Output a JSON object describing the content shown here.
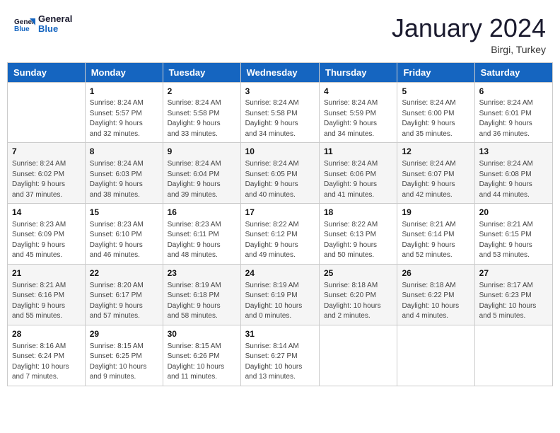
{
  "logo": {
    "line1": "General",
    "line2": "Blue"
  },
  "title": "January 2024",
  "location": "Birgi, Turkey",
  "header": {
    "days": [
      "Sunday",
      "Monday",
      "Tuesday",
      "Wednesday",
      "Thursday",
      "Friday",
      "Saturday"
    ]
  },
  "weeks": [
    [
      {
        "day": "",
        "info": ""
      },
      {
        "day": "1",
        "info": "Sunrise: 8:24 AM\nSunset: 5:57 PM\nDaylight: 9 hours\nand 32 minutes."
      },
      {
        "day": "2",
        "info": "Sunrise: 8:24 AM\nSunset: 5:58 PM\nDaylight: 9 hours\nand 33 minutes."
      },
      {
        "day": "3",
        "info": "Sunrise: 8:24 AM\nSunset: 5:58 PM\nDaylight: 9 hours\nand 34 minutes."
      },
      {
        "day": "4",
        "info": "Sunrise: 8:24 AM\nSunset: 5:59 PM\nDaylight: 9 hours\nand 34 minutes."
      },
      {
        "day": "5",
        "info": "Sunrise: 8:24 AM\nSunset: 6:00 PM\nDaylight: 9 hours\nand 35 minutes."
      },
      {
        "day": "6",
        "info": "Sunrise: 8:24 AM\nSunset: 6:01 PM\nDaylight: 9 hours\nand 36 minutes."
      }
    ],
    [
      {
        "day": "7",
        "info": "Sunrise: 8:24 AM\nSunset: 6:02 PM\nDaylight: 9 hours\nand 37 minutes."
      },
      {
        "day": "8",
        "info": "Sunrise: 8:24 AM\nSunset: 6:03 PM\nDaylight: 9 hours\nand 38 minutes."
      },
      {
        "day": "9",
        "info": "Sunrise: 8:24 AM\nSunset: 6:04 PM\nDaylight: 9 hours\nand 39 minutes."
      },
      {
        "day": "10",
        "info": "Sunrise: 8:24 AM\nSunset: 6:05 PM\nDaylight: 9 hours\nand 40 minutes."
      },
      {
        "day": "11",
        "info": "Sunrise: 8:24 AM\nSunset: 6:06 PM\nDaylight: 9 hours\nand 41 minutes."
      },
      {
        "day": "12",
        "info": "Sunrise: 8:24 AM\nSunset: 6:07 PM\nDaylight: 9 hours\nand 42 minutes."
      },
      {
        "day": "13",
        "info": "Sunrise: 8:24 AM\nSunset: 6:08 PM\nDaylight: 9 hours\nand 44 minutes."
      }
    ],
    [
      {
        "day": "14",
        "info": "Sunrise: 8:23 AM\nSunset: 6:09 PM\nDaylight: 9 hours\nand 45 minutes."
      },
      {
        "day": "15",
        "info": "Sunrise: 8:23 AM\nSunset: 6:10 PM\nDaylight: 9 hours\nand 46 minutes."
      },
      {
        "day": "16",
        "info": "Sunrise: 8:23 AM\nSunset: 6:11 PM\nDaylight: 9 hours\nand 48 minutes."
      },
      {
        "day": "17",
        "info": "Sunrise: 8:22 AM\nSunset: 6:12 PM\nDaylight: 9 hours\nand 49 minutes."
      },
      {
        "day": "18",
        "info": "Sunrise: 8:22 AM\nSunset: 6:13 PM\nDaylight: 9 hours\nand 50 minutes."
      },
      {
        "day": "19",
        "info": "Sunrise: 8:21 AM\nSunset: 6:14 PM\nDaylight: 9 hours\nand 52 minutes."
      },
      {
        "day": "20",
        "info": "Sunrise: 8:21 AM\nSunset: 6:15 PM\nDaylight: 9 hours\nand 53 minutes."
      }
    ],
    [
      {
        "day": "21",
        "info": "Sunrise: 8:21 AM\nSunset: 6:16 PM\nDaylight: 9 hours\nand 55 minutes."
      },
      {
        "day": "22",
        "info": "Sunrise: 8:20 AM\nSunset: 6:17 PM\nDaylight: 9 hours\nand 57 minutes."
      },
      {
        "day": "23",
        "info": "Sunrise: 8:19 AM\nSunset: 6:18 PM\nDaylight: 9 hours\nand 58 minutes."
      },
      {
        "day": "24",
        "info": "Sunrise: 8:19 AM\nSunset: 6:19 PM\nDaylight: 10 hours\nand 0 minutes."
      },
      {
        "day": "25",
        "info": "Sunrise: 8:18 AM\nSunset: 6:20 PM\nDaylight: 10 hours\nand 2 minutes."
      },
      {
        "day": "26",
        "info": "Sunrise: 8:18 AM\nSunset: 6:22 PM\nDaylight: 10 hours\nand 4 minutes."
      },
      {
        "day": "27",
        "info": "Sunrise: 8:17 AM\nSunset: 6:23 PM\nDaylight: 10 hours\nand 5 minutes."
      }
    ],
    [
      {
        "day": "28",
        "info": "Sunrise: 8:16 AM\nSunset: 6:24 PM\nDaylight: 10 hours\nand 7 minutes."
      },
      {
        "day": "29",
        "info": "Sunrise: 8:15 AM\nSunset: 6:25 PM\nDaylight: 10 hours\nand 9 minutes."
      },
      {
        "day": "30",
        "info": "Sunrise: 8:15 AM\nSunset: 6:26 PM\nDaylight: 10 hours\nand 11 minutes."
      },
      {
        "day": "31",
        "info": "Sunrise: 8:14 AM\nSunset: 6:27 PM\nDaylight: 10 hours\nand 13 minutes."
      },
      {
        "day": "",
        "info": ""
      },
      {
        "day": "",
        "info": ""
      },
      {
        "day": "",
        "info": ""
      }
    ]
  ]
}
